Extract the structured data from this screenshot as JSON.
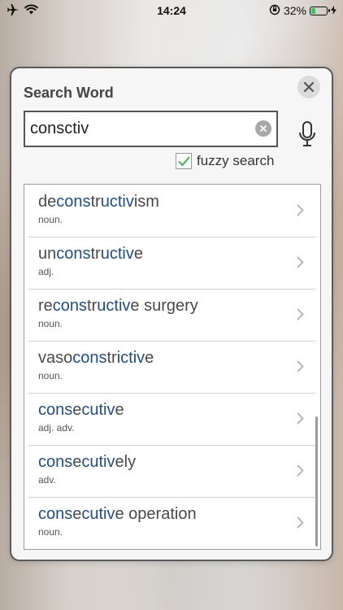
{
  "status_bar": {
    "time": "14:24",
    "battery": "32%",
    "battery_level": 0.32,
    "icons": [
      "airplane-icon",
      "wifi-icon",
      "orientation-lock-icon",
      "battery-icon",
      "charging-icon"
    ]
  },
  "dialog": {
    "title": "Search Word",
    "close_icon": "close-icon"
  },
  "search": {
    "value": "consctiv",
    "placeholder": "",
    "clear_icon": "clear-icon",
    "mic_icon": "microphone-icon"
  },
  "fuzzy": {
    "label": "fuzzy search",
    "checked": true
  },
  "colors": {
    "match_highlight": "#1e4e8c",
    "checkmark": "#3bb54a"
  },
  "results": [
    {
      "word": "deconstructivism",
      "pos": "noun.",
      "segments": [
        [
          "de",
          false
        ],
        [
          "cons",
          true
        ],
        [
          "tr",
          false
        ],
        [
          "uctiv",
          true
        ],
        [
          "ism",
          false
        ]
      ]
    },
    {
      "word": "unconstructive",
      "pos": "adj.",
      "segments": [
        [
          "un",
          false
        ],
        [
          "cons",
          true
        ],
        [
          "tr",
          false
        ],
        [
          "uctiv",
          true
        ],
        [
          "e",
          false
        ]
      ]
    },
    {
      "word": "reconstructive surgery",
      "pos": "noun.",
      "segments": [
        [
          "re",
          false
        ],
        [
          "cons",
          true
        ],
        [
          "tr",
          false
        ],
        [
          "uctiv",
          true
        ],
        [
          "e surgery",
          false
        ]
      ]
    },
    {
      "word": "vasoconstrictive",
      "pos": "noun.",
      "segments": [
        [
          "vaso",
          false
        ],
        [
          "cons",
          true
        ],
        [
          "tr",
          false
        ],
        [
          "ictiv",
          true
        ],
        [
          "e",
          false
        ]
      ]
    },
    {
      "word": "consecutive",
      "pos": "adj. adv.",
      "segments": [
        [
          "cons",
          true
        ],
        [
          "e",
          false
        ],
        [
          "cutiv",
          true
        ],
        [
          "e",
          false
        ]
      ]
    },
    {
      "word": "consecutively",
      "pos": "adv.",
      "segments": [
        [
          "cons",
          true
        ],
        [
          "e",
          false
        ],
        [
          "cutiv",
          true
        ],
        [
          "ely",
          false
        ]
      ]
    },
    {
      "word": "consecutive operation",
      "pos": "noun.",
      "segments": [
        [
          "cons",
          true
        ],
        [
          "e",
          false
        ],
        [
          "cutiv",
          true
        ],
        [
          "e operation",
          false
        ]
      ]
    }
  ]
}
